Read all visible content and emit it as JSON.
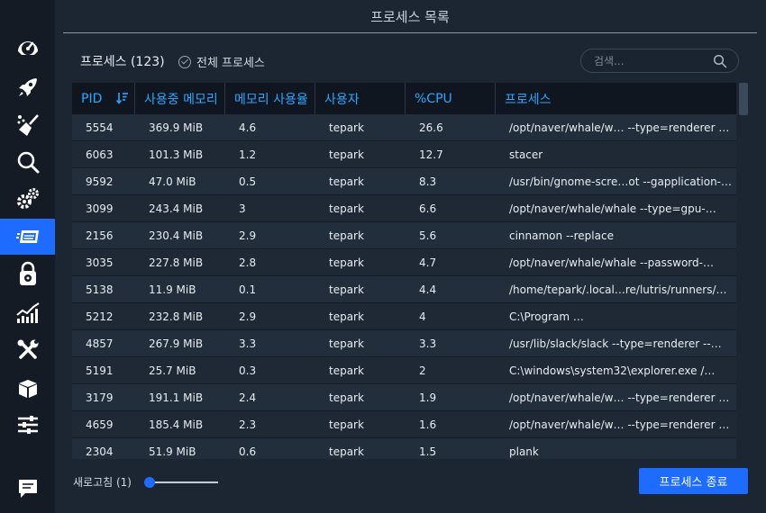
{
  "header": {
    "title": "프로세스 목록"
  },
  "toolbar": {
    "process_count": "프로세스 (123)",
    "all_processes_label": "전체 프로세스",
    "search_placeholder": "검색..."
  },
  "sidebar": {
    "items": [
      {
        "icon": "dashboard-icon",
        "active": false
      },
      {
        "icon": "rocket-icon",
        "active": false
      },
      {
        "icon": "broom-icon",
        "active": false
      },
      {
        "icon": "magnifier-icon",
        "active": false
      },
      {
        "icon": "gears-icon",
        "active": false
      },
      {
        "icon": "processes-icon",
        "active": true
      },
      {
        "icon": "disk-lock-icon",
        "active": false
      },
      {
        "icon": "chart-icon",
        "active": false
      },
      {
        "icon": "tools-icon",
        "active": false
      },
      {
        "icon": "package-icon",
        "active": false
      },
      {
        "icon": "sliders-icon",
        "active": false
      },
      {
        "icon": "feedback-icon",
        "active": false
      }
    ]
  },
  "table": {
    "columns": [
      "PID",
      "사용중 메모리",
      "메모리 사용율",
      "사용자",
      "%CPU",
      "프로세스"
    ],
    "rows": [
      [
        "5554",
        "369.9 MiB",
        "4.6",
        "tepark",
        "26.6",
        "/opt/naver/whale/w… --type=renderer …"
      ],
      [
        "6063",
        "101.3 MiB",
        "1.2",
        "tepark",
        "12.7",
        "stacer"
      ],
      [
        "9592",
        "47.0 MiB",
        "0.5",
        "tepark",
        "8.3",
        "/usr/bin/gnome-scre…ot --gapplication-…"
      ],
      [
        "3099",
        "243.4 MiB",
        "3",
        "tepark",
        "6.6",
        "/opt/naver/whale/whale --type=gpu-…"
      ],
      [
        "2156",
        "230.4 MiB",
        "2.9",
        "tepark",
        "5.6",
        "cinnamon --replace"
      ],
      [
        "3035",
        "227.8 MiB",
        "2.8",
        "tepark",
        "4.7",
        "/opt/naver/whale/whale --password-…"
      ],
      [
        "5138",
        "11.9 MiB",
        "0.1",
        "tepark",
        "4.4",
        "/home/tepark/.local…re/lutris/runners/…"
      ],
      [
        "5212",
        "232.8 MiB",
        "2.9",
        "tepark",
        "4",
        "C:\\Program …"
      ],
      [
        "4857",
        "267.9 MiB",
        "3.3",
        "tepark",
        "3.3",
        "/usr/lib/slack/slack --type=renderer --…"
      ],
      [
        "5191",
        "25.7 MiB",
        "0.3",
        "tepark",
        "2",
        "C:\\windows\\system32\\explorer.exe /…"
      ],
      [
        "3179",
        "191.1 MiB",
        "2.4",
        "tepark",
        "1.9",
        "/opt/naver/whale/w… --type=renderer …"
      ],
      [
        "4659",
        "185.4 MiB",
        "2.3",
        "tepark",
        "1.6",
        "/opt/naver/whale/w… --type=renderer …"
      ],
      [
        "2304",
        "51.9 MiB",
        "0.6",
        "tepark",
        "1.5",
        "plank"
      ]
    ]
  },
  "footer": {
    "refresh_label": "새로고침 (1)",
    "refresh_interval": 1,
    "end_process_label": "프로세스 종료"
  },
  "colors": {
    "accent": "#1e6cff",
    "header_text": "#2aa7ff",
    "background": "#1c2633"
  }
}
